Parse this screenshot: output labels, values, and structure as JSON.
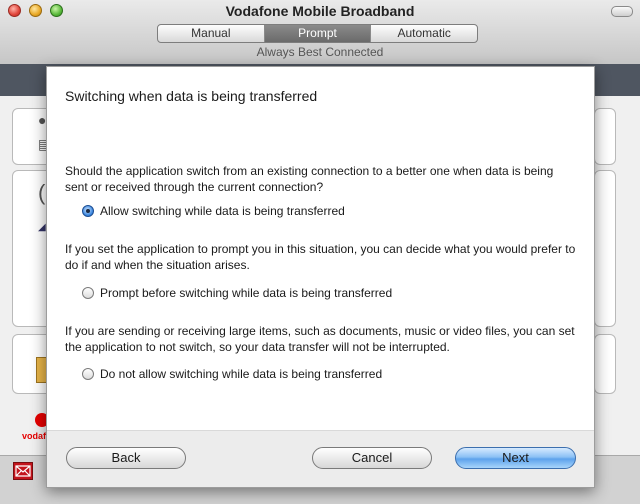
{
  "window": {
    "title": "Vodafone Mobile Broadband",
    "subtitle": "Always Best Connected",
    "modes": [
      {
        "label": "Manual",
        "active": false
      },
      {
        "label": "Prompt",
        "active": true
      },
      {
        "label": "Automatic",
        "active": false
      }
    ]
  },
  "sheet": {
    "title": "Switching when data is being transferred",
    "question": "Should the application switch from an existing connection to a better one when data is being sent or received through the current connection?",
    "option_allow": "Allow switching while data is being transferred",
    "prompt_explain": "If you set the application to prompt you in this situation, you can decide what you would prefer to do if and when the situation arises.",
    "option_prompt": "Prompt before switching while data is being transferred",
    "noswitch_explain": "If you are sending or receiving large items, such as documents, music or video files, you can set the application to not switch, so your data transfer will not be interrupted.",
    "option_noswitch": "Do not allow switching while data is being transferred",
    "selected_option": "allow",
    "buttons": {
      "back": "Back",
      "cancel": "Cancel",
      "next": "Next"
    }
  },
  "background": {
    "brand": "vodafone"
  },
  "colors": {
    "accent": "#3a86df",
    "brand_red": "#e60000",
    "band": "#4f5661"
  },
  "icons": [
    "close-window-icon",
    "minimize-window-icon",
    "zoom-window-icon",
    "toolbar-toggle-icon",
    "vodafone-logo-icon",
    "mail-icon"
  ]
}
